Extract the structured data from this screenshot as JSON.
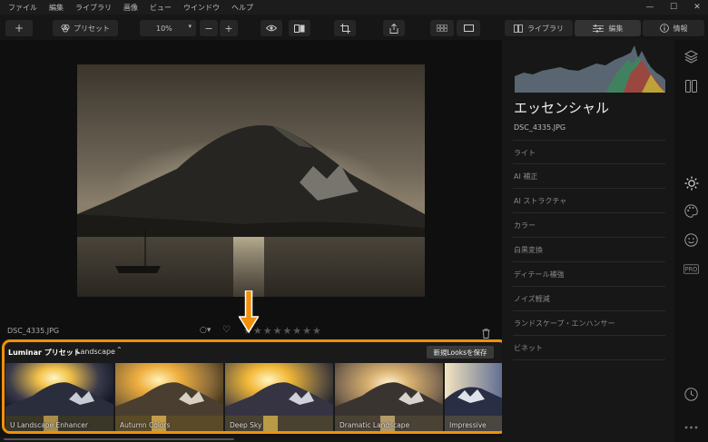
{
  "menu": [
    "ファイル",
    "編集",
    "ライブラリ",
    "画像",
    "ビュー",
    "ウインドウ",
    "ヘルプ"
  ],
  "window_controls": [
    "—",
    "☐",
    "✕"
  ],
  "toolbar": {
    "add_label": "+",
    "preset_label": "プリセット",
    "zoom_value": "10%",
    "zoom_minus": "−",
    "zoom_plus": "+",
    "library_label": "ライブラリ",
    "edit_label": "編集",
    "info_label": "情報"
  },
  "viewer": {
    "filename": "DSC_4335.JPG"
  },
  "presets": {
    "title": "Luminar プリセット",
    "category": "Landscape",
    "save_label": "新規Looksを保存",
    "items": [
      {
        "name": "U Landscape Enhancer"
      },
      {
        "name": "Autumn Colors"
      },
      {
        "name": "Deep Sky"
      },
      {
        "name": "Dramatic Landscape"
      },
      {
        "name": "Impressive"
      }
    ]
  },
  "panel": {
    "title": "エッセンシャル",
    "file": "DSC_4335.JPG",
    "sections": [
      "ライト",
      "AI 補正",
      "AI ストラクチャ",
      "カラー",
      "白黒変換",
      "ディテール補強",
      "ノイズ軽減",
      "ランドスケープ・エンハンサー",
      "ビネット"
    ]
  },
  "side_icons": [
    "layers-icon",
    "compare-icon",
    "sun-icon",
    "palette-icon",
    "smile-icon",
    "pro-icon",
    "clock-icon",
    "more-icon"
  ],
  "colors": {
    "accent": "#f0900c"
  }
}
